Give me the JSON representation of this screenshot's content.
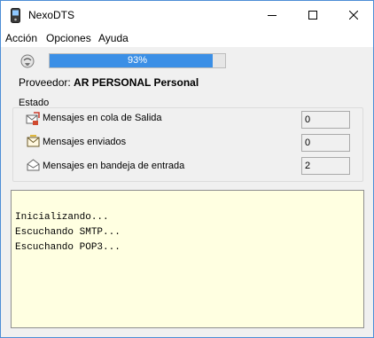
{
  "window": {
    "title": "NexoDTS"
  },
  "menu": {
    "items": [
      "Acción",
      "Opciones",
      "Ayuda"
    ]
  },
  "progress": {
    "value": 0.93,
    "label": "93%"
  },
  "provider": {
    "label": "Proveedor:",
    "value": "AR PERSONAL Personal"
  },
  "estado": {
    "title": "Estado",
    "rows": [
      {
        "label": "Mensajes en cola de Salida",
        "value": "0",
        "icon": "outbox-queue-icon"
      },
      {
        "label": "Mensajes enviados",
        "value": "0",
        "icon": "sent-mail-icon"
      },
      {
        "label": "Mensajes en bandeja de entrada",
        "value": "2",
        "icon": "inbox-mail-icon"
      }
    ]
  },
  "log": {
    "lines": [
      "Inicializando...",
      "Escuchando SMTP...",
      "Escuchando POP3..."
    ]
  },
  "colors": {
    "progress": "#3b8fe6",
    "log_bg": "#ffffe1",
    "window_bg": "#f0f0f0"
  }
}
